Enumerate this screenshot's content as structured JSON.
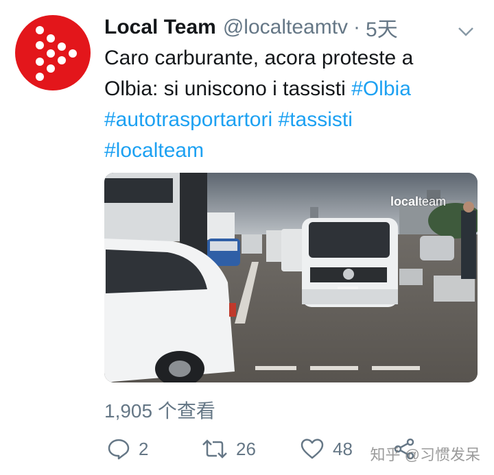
{
  "tweet": {
    "author_name": "Local Team",
    "handle": "@localteamtv",
    "separator": "·",
    "time": "5天",
    "text_line1": "Caro carburante, acora proteste a",
    "text_line2_plain": "Olbia: si uniscono i tassisti ",
    "hashtag_olbia": "#Olbia",
    "hashtag_autotrasportartori": "#autotrasportartori",
    "hashtag_tassisti": "#tassisti",
    "hashtag_localteam": "#localteam",
    "media_watermark_bold": "local",
    "media_watermark_thin": "team",
    "views": "1,905 个查看"
  },
  "actions": {
    "reply_count": "2",
    "retweet_count": "26",
    "like_count": "48"
  },
  "overlay": {
    "zhihu_watermark": "知乎 @习惯发呆"
  },
  "icons": {
    "avatar": "localteam-logo-icon",
    "caret": "chevron-down-icon",
    "reply": "reply-icon",
    "retweet": "retweet-icon",
    "like": "heart-icon",
    "share": "share-icon"
  },
  "colors": {
    "brand_red": "#e3161b",
    "link_blue": "#1da1f2",
    "muted_gray": "#657786"
  }
}
